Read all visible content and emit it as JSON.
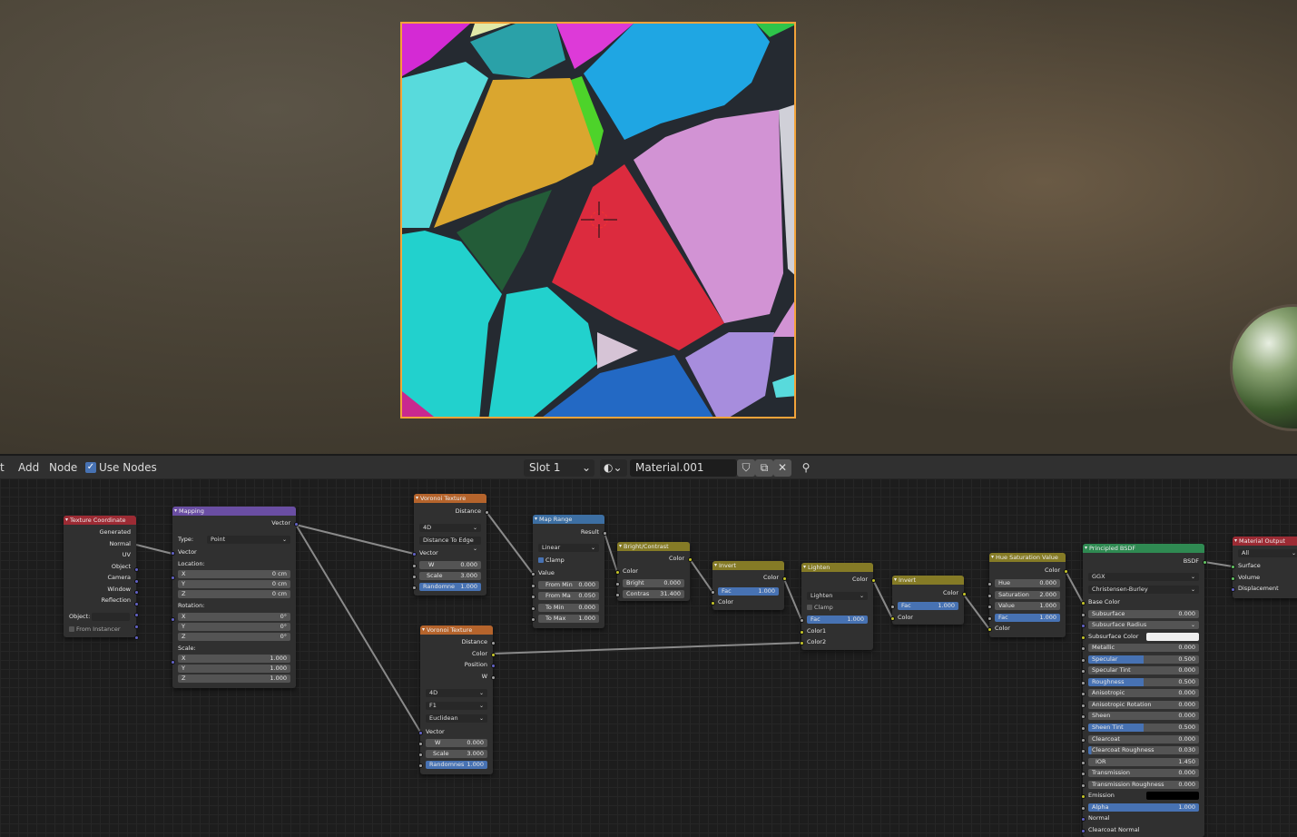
{
  "header": {
    "menu_view": "t",
    "menu_add": "Add",
    "menu_node": "Node",
    "use_nodes": "Use Nodes",
    "slot": "Slot 1",
    "material": "Material.001"
  },
  "nodes": {
    "texcoord": {
      "title": "Texture Coordinate",
      "outputs": [
        "Generated",
        "Normal",
        "UV",
        "Object",
        "Camera",
        "Window",
        "Reflection"
      ],
      "object_label": "Object:",
      "from_instancer": "From Instancer"
    },
    "mapping": {
      "title": "Mapping",
      "out": "Vector",
      "type_label": "Type:",
      "type_value": "Point",
      "vector": "Vector",
      "location": "Location:",
      "rotation": "Rotation:",
      "scale": "Scale:",
      "loc": [
        [
          "X",
          "0 cm"
        ],
        [
          "Y",
          "0 cm"
        ],
        [
          "Z",
          "0 cm"
        ]
      ],
      "rot": [
        [
          "X",
          "0°"
        ],
        [
          "Y",
          "0°"
        ],
        [
          "Z",
          "0°"
        ]
      ],
      "scl": [
        [
          "X",
          "1.000"
        ],
        [
          "Y",
          "1.000"
        ],
        [
          "Z",
          "1.000"
        ]
      ]
    },
    "voronoi1": {
      "title": "Voronoi Texture",
      "out": "Distance",
      "dim": "4D",
      "feature": "Distance To Edge",
      "vector": "Vector",
      "w": [
        "W",
        "0.000"
      ],
      "scale": [
        "Scale",
        "3.000"
      ],
      "rand": [
        "Randomne",
        "1.000"
      ]
    },
    "voronoi2": {
      "title": "Voronoi Texture",
      "outs": [
        "Distance",
        "Color",
        "Position",
        "W"
      ],
      "dim": "4D",
      "feature": "F1",
      "metric": "Euclidean",
      "vector": "Vector",
      "w": [
        "W",
        "0.000"
      ],
      "scale": [
        "Scale",
        "3.000"
      ],
      "rand": [
        "Randomnes",
        "1.000"
      ]
    },
    "maprange": {
      "title": "Map Range",
      "out": "Result",
      "interp": "Linear",
      "clamp": "Clamp",
      "value": "Value",
      "fields": [
        [
          "From Min",
          "0.000"
        ],
        [
          "From Ma",
          "0.050"
        ],
        [
          "To Min",
          "0.000"
        ],
        [
          "To Max",
          "1.000"
        ]
      ]
    },
    "bright": {
      "title": "Bright/Contrast",
      "out": "Color",
      "color": "Color",
      "bright": [
        "Bright",
        "0.000"
      ],
      "contrast": [
        "Contras",
        "31.400"
      ]
    },
    "invert1": {
      "title": "Invert",
      "out": "Color",
      "fac": [
        "Fac",
        "1.000"
      ],
      "color": "Color"
    },
    "lighten": {
      "title": "Lighten",
      "out": "Color",
      "mode": "Lighten",
      "clamp": "Clamp",
      "fac": [
        "Fac",
        "1.000"
      ],
      "color1": "Color1",
      "color2": "Color2"
    },
    "invert2": {
      "title": "Invert",
      "out": "Color",
      "fac": [
        "Fac",
        "1.000"
      ],
      "color": "Color"
    },
    "huesat": {
      "title": "Hue Saturation Value",
      "out": "Color",
      "hue": [
        "Hue",
        "0.000"
      ],
      "sat": [
        "Saturation",
        "2.000"
      ],
      "val": [
        "Value",
        "1.000"
      ],
      "fac": [
        "Fac",
        "1.000"
      ],
      "color": "Color"
    },
    "bsdf": {
      "title": "Principled BSDF",
      "out": "BSDF",
      "dist": "GGX",
      "sss": "Christensen-Burley",
      "base_color": "Base Color",
      "subsurface_radius": "Subsurface Radius",
      "subsurface_color": "Subsurface Color",
      "emission": "Emission",
      "normal": "Normal",
      "clearcoat_normal": "Clearcoat Normal",
      "rows": [
        [
          "Subsurface",
          "0.000",
          0
        ],
        [
          "Metallic",
          "0.000",
          0
        ],
        [
          "Specular",
          "0.500",
          0.5
        ],
        [
          "Specular Tint",
          "0.000",
          0
        ],
        [
          "Roughness",
          "0.500",
          0.5
        ],
        [
          "Anisotropic",
          "0.000",
          0
        ],
        [
          "Anisotropic Rotation",
          "0.000",
          0
        ],
        [
          "Sheen",
          "0.000",
          0
        ],
        [
          "Sheen Tint",
          "0.500",
          0.5
        ],
        [
          "Clearcoat",
          "0.000",
          0
        ],
        [
          "Clearcoat Roughness",
          "0.030",
          0.03
        ],
        [
          "IOR",
          "1.450",
          0
        ],
        [
          "Transmission",
          "0.000",
          0
        ],
        [
          "Transmission Roughness",
          "0.000",
          0
        ]
      ],
      "alpha": [
        "Alpha",
        "1.000"
      ]
    },
    "output": {
      "title": "Material Output",
      "target": "All",
      "inputs": [
        "Surface",
        "Volume",
        "Displacement"
      ]
    }
  }
}
